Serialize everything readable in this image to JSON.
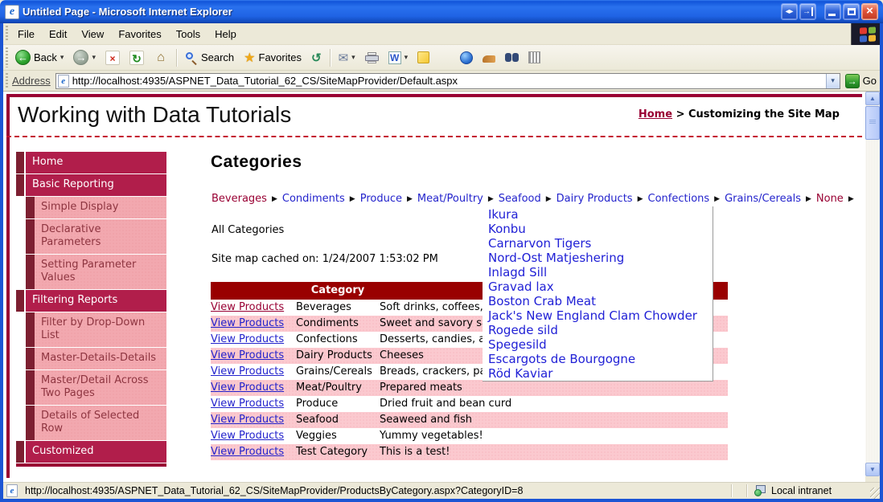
{
  "window": {
    "title": "Untitled Page - Microsoft Internet Explorer"
  },
  "menu_bar": {
    "items": [
      "File",
      "Edit",
      "View",
      "Favorites",
      "Tools",
      "Help"
    ]
  },
  "toolbar": {
    "back_label": "Back",
    "search_label": "Search",
    "favorites_label": "Favorites"
  },
  "address_bar": {
    "label": "Address",
    "url": "http://localhost:4935/ASPNET_Data_Tutorial_62_CS/SiteMapProvider/Default.aspx",
    "go_label": "Go"
  },
  "icons": {
    "ie": "e",
    "back_arrow": "←",
    "forward_arrow": "→",
    "stop": "×",
    "refresh": "↻",
    "home": "⌂",
    "favorites_star": "★",
    "history": "↺",
    "mail": "✉",
    "word": "W",
    "dropdown": "▾",
    "go_arrow": "→",
    "menu_arrow": "▶",
    "scroll_up": "▲",
    "scroll_down": "▼",
    "window_nav": "◂▸",
    "close": "×"
  },
  "page": {
    "site_title": "Working with Data Tutorials",
    "breadcrumb": {
      "home": "Home",
      "separator": " > ",
      "current": "Customizing the Site Map"
    },
    "sidebar": {
      "items": [
        {
          "label": "Home",
          "level": 1
        },
        {
          "label": "Basic Reporting",
          "level": 1
        },
        {
          "label": "Simple Display",
          "level": 2
        },
        {
          "label": "Declarative Parameters",
          "level": 2
        },
        {
          "label": "Setting Parameter Values",
          "level": 2
        },
        {
          "label": "Filtering Reports",
          "level": 1
        },
        {
          "label": "Filter by Drop-Down List",
          "level": 2
        },
        {
          "label": "Master-Details-Details",
          "level": 2
        },
        {
          "label": "Master/Detail Across Two Pages",
          "level": 2
        },
        {
          "label": "Details of Selected Row",
          "level": 2
        },
        {
          "label": "Customized",
          "level": 1
        }
      ]
    },
    "main": {
      "heading": "Categories",
      "category_menu": {
        "items": [
          {
            "label": "Beverages",
            "highlighted": true
          },
          {
            "label": "Condiments",
            "highlighted": false
          },
          {
            "label": "Produce",
            "highlighted": false
          },
          {
            "label": "Meat/Poultry",
            "highlighted": false
          },
          {
            "label": "Seafood",
            "highlighted": false
          },
          {
            "label": "Dairy Products",
            "highlighted": false
          },
          {
            "label": "Confections",
            "highlighted": false
          },
          {
            "label": "Grains/Cereals",
            "highlighted": false
          },
          {
            "label": "None",
            "highlighted": true
          }
        ]
      },
      "all_categories": "All Categories",
      "cache_note": "Site map cached on: 1/24/2007 1:53:02 PM",
      "table": {
        "link_label": "View Products",
        "category_header": "Category",
        "rows": [
          {
            "category": "Beverages",
            "description": "Soft drinks, coffees, teas, beers, and ales",
            "visited": true
          },
          {
            "category": "Condiments",
            "description": "Sweet and savory sauces, relishes, spreads, and seasonings",
            "visited": false
          },
          {
            "category": "Confections",
            "description": "Desserts, candies, and sweet breads",
            "visited": false
          },
          {
            "category": "Dairy Products",
            "description": "Cheeses",
            "visited": false
          },
          {
            "category": "Grains/Cereals",
            "description": "Breads, crackers, pasta, and cereal",
            "visited": false
          },
          {
            "category": "Meat/Poultry",
            "description": "Prepared meats",
            "visited": false
          },
          {
            "category": "Produce",
            "description": "Dried fruit and bean curd",
            "visited": false
          },
          {
            "category": "Seafood",
            "description": "Seaweed and fish",
            "visited": false
          },
          {
            "category": "Veggies",
            "description": "Yummy vegetables!",
            "visited": false
          },
          {
            "category": "Test Category",
            "description": "This is a test!",
            "visited": false
          }
        ]
      },
      "products_flyout": {
        "items": [
          "Ikura",
          "Konbu",
          "Carnarvon Tigers",
          "Nord-Ost Matjeshering",
          "Inlagd Sill",
          "Gravad lax",
          "Boston Crab Meat",
          "Jack's New England Clam Chowder",
          "Rogede sild",
          "Spegesild",
          "Escargots de Bourgogne",
          "Röd Kaviar"
        ]
      }
    }
  },
  "status_bar": {
    "url": "http://localhost:4935/ASPNET_Data_Tutorial_62_CS/SiteMapProvider/ProductsByCategory.aspx?CategoryID=8",
    "zone": "Local intranet"
  },
  "colors": {
    "maroon_accent": "#990033",
    "table_header_red": "#990000",
    "sidebar_crimson": "#b11e4b",
    "sidebar_dark_tab": "#7d1f31",
    "row_pink": "#fbc9cf",
    "link_blue": "#2323cc",
    "titlebar_blue": "#1f63e4",
    "chrome_beige": "#ece9d8"
  }
}
